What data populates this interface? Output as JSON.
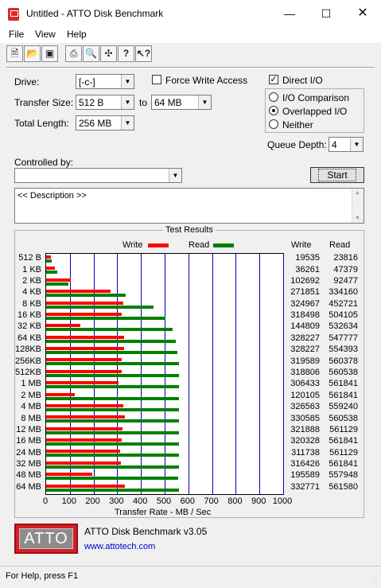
{
  "window": {
    "title": "Untitled - ATTO Disk Benchmark"
  },
  "menu": [
    "File",
    "View",
    "Help"
  ],
  "toolbar": [
    "new-icon",
    "open-icon",
    "save-icon",
    "print-icon",
    "print-preview-icon",
    "move-icon",
    "help-icon",
    "context-help-icon"
  ],
  "settings": {
    "drive_label": "Drive:",
    "drive_value": "[-c-]",
    "transfer_size_label": "Transfer Size:",
    "transfer_from": "512 B",
    "transfer_to_label": "to",
    "transfer_to": "64 MB",
    "total_length_label": "Total Length:",
    "total_length_value": "256 MB",
    "force_write_label": "Force Write Access",
    "force_write_checked": false,
    "direct_io_label": "Direct I/O",
    "direct_io_checked": true,
    "io_comparison_label": "I/O Comparison",
    "overlapped_label": "Overlapped I/O",
    "neither_label": "Neither",
    "selected_mode": "Overlapped I/O",
    "queue_depth_label": "Queue Depth:",
    "queue_depth_value": "4",
    "controlled_by_label": "Controlled by:",
    "controlled_by_value": "",
    "start_label": "Start",
    "description_text": "<< Description >>"
  },
  "results": {
    "title": "Test Results",
    "legend_write": "Write",
    "legend_read": "Read",
    "col_write": "Write",
    "col_read": "Read",
    "xlabel": "Transfer Rate - MB / Sec",
    "colors": {
      "write": "#ff0000",
      "read": "#008000",
      "grid": "#0000c0"
    }
  },
  "chart_data": {
    "type": "bar",
    "title": "Test Results",
    "xlabel": "Transfer Rate - MB / Sec",
    "ylabel": "",
    "xlim": [
      0,
      1000
    ],
    "xticks": [
      "0",
      "100",
      "200",
      "300",
      "400",
      "500",
      "600",
      "700",
      "800",
      "900",
      "1000"
    ],
    "categories": [
      "512 B",
      "1 KB",
      "2 KB",
      "4 KB",
      "8 KB",
      "16 KB",
      "32 KB",
      "64 KB",
      "128KB",
      "256KB",
      "512KB",
      "1 MB",
      "2 MB",
      "4 MB",
      "8 MB",
      "12 MB",
      "16 MB",
      "24 MB",
      "32 MB",
      "48 MB",
      "64 MB"
    ],
    "series": [
      {
        "name": "Write",
        "values": [
          19535,
          36261,
          102692,
          271851,
          324967,
          318498,
          144809,
          328227,
          328227,
          319589,
          318806,
          306433,
          120105,
          326563,
          330585,
          321888,
          320328,
          311738,
          316426,
          195589,
          332771
        ]
      },
      {
        "name": "Read",
        "values": [
          23816,
          47379,
          92477,
          334160,
          452721,
          504105,
          532634,
          547777,
          554393,
          560378,
          560538,
          561841,
          561841,
          559240,
          560538,
          561129,
          561841,
          561129,
          561841,
          557948,
          561580
        ]
      }
    ],
    "grid": true,
    "legend": "top"
  },
  "footer": {
    "logo": "ATTO",
    "product": "ATTO Disk Benchmark v3.05",
    "url": "www.attotech.com"
  },
  "status": "For Help, press F1"
}
